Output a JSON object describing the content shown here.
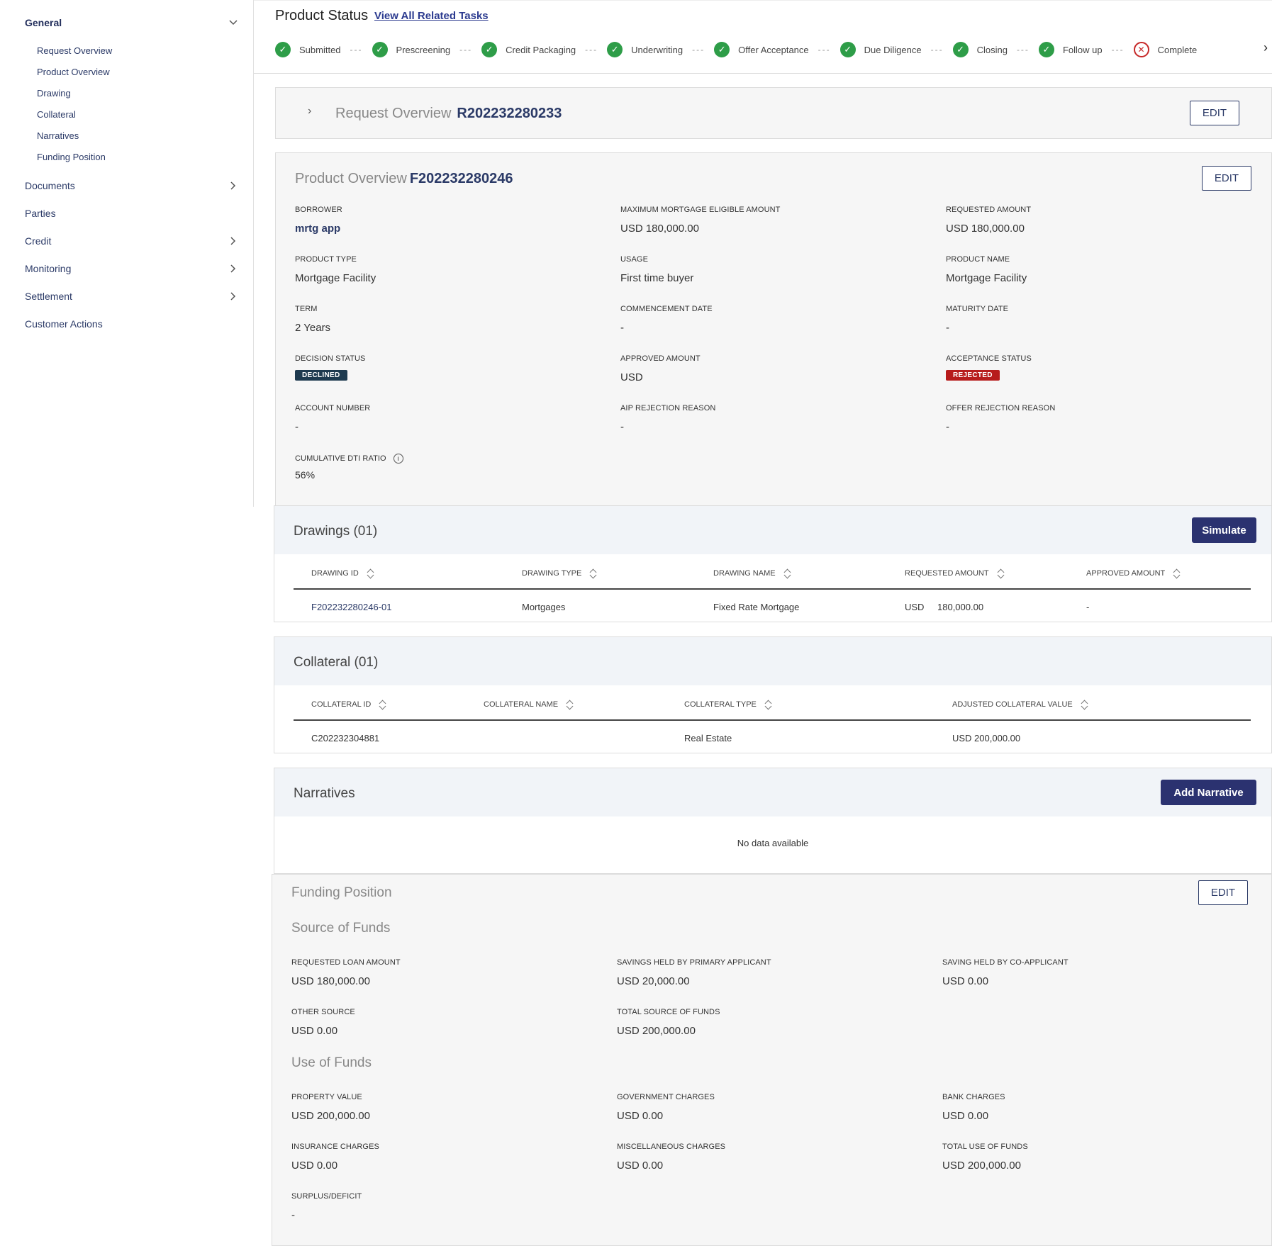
{
  "sidebar": {
    "groups": [
      {
        "label": "General"
      },
      {
        "label": "Documents"
      },
      {
        "label": "Parties"
      },
      {
        "label": "Credit"
      },
      {
        "label": "Monitoring"
      },
      {
        "label": "Settlement"
      },
      {
        "label": "Customer Actions"
      }
    ],
    "general_items": [
      {
        "label": "Request Overview"
      },
      {
        "label": "Product Overview"
      },
      {
        "label": "Drawing"
      },
      {
        "label": "Collateral"
      },
      {
        "label": "Narratives"
      },
      {
        "label": "Funding Position"
      }
    ]
  },
  "status": {
    "title": "Product Status",
    "link": "View All Related Tasks",
    "steps": [
      {
        "label": "Submitted",
        "state": "done"
      },
      {
        "label": "Prescreening",
        "state": "done"
      },
      {
        "label": "Credit Packaging",
        "state": "done"
      },
      {
        "label": "Underwriting",
        "state": "done"
      },
      {
        "label": "Offer Acceptance",
        "state": "done"
      },
      {
        "label": "Due Diligence",
        "state": "done"
      },
      {
        "label": "Closing",
        "state": "done"
      },
      {
        "label": "Follow up",
        "state": "done"
      },
      {
        "label": "Complete",
        "state": "failed"
      }
    ]
  },
  "request_overview": {
    "title": "Request Overview",
    "id": "R202232280233",
    "edit": "EDIT"
  },
  "product_overview": {
    "title": "Product Overview",
    "id": "F202232280246",
    "edit": "EDIT",
    "fields": {
      "borrower": {
        "label": "BORROWER",
        "value": "mrtg app"
      },
      "max_mortgage": {
        "label": "MAXIMUM MORTGAGE ELIGIBLE AMOUNT",
        "value": "USD 180,000.00"
      },
      "requested_amount": {
        "label": "REQUESTED AMOUNT",
        "value": "USD 180,000.00"
      },
      "product_type": {
        "label": "PRODUCT TYPE",
        "value": "Mortgage Facility"
      },
      "usage": {
        "label": "USAGE",
        "value": "First time buyer"
      },
      "product_name": {
        "label": "PRODUCT NAME",
        "value": "Mortgage Facility"
      },
      "term": {
        "label": "TERM",
        "value": "2 Years"
      },
      "commencement": {
        "label": "COMMENCEMENT DATE",
        "value": "-"
      },
      "maturity": {
        "label": "MATURITY DATE",
        "value": "-"
      },
      "decision_status": {
        "label": "DECISION STATUS",
        "value": "DECLINED"
      },
      "approved_amount": {
        "label": "APPROVED AMOUNT",
        "value": "USD"
      },
      "acceptance_status": {
        "label": "ACCEPTANCE STATUS",
        "value": "REJECTED"
      },
      "account_number": {
        "label": "ACCOUNT NUMBER",
        "value": "-"
      },
      "aip_rejection": {
        "label": "AIP REJECTION REASON",
        "value": "-"
      },
      "offer_rejection": {
        "label": "OFFER REJECTION REASON",
        "value": "-"
      },
      "dti": {
        "label": "CUMULATIVE DTI RATIO",
        "value": "56%"
      }
    },
    "colors": {
      "declined": "#1e3a4f",
      "rejected": "#b71c1c"
    }
  },
  "drawings": {
    "title": "Drawings (01)",
    "button": "Simulate",
    "columns": [
      "DRAWING ID",
      "DRAWING TYPE",
      "DRAWING NAME",
      "REQUESTED AMOUNT",
      "APPROVED AMOUNT"
    ],
    "rows": [
      {
        "id": "F202232280246-01",
        "type": "Mortgages",
        "name": "Fixed Rate Mortgage",
        "currency": "USD",
        "requested": "180,000.00",
        "approved": "-"
      }
    ]
  },
  "collateral": {
    "title": "Collateral (01)",
    "columns": [
      "COLLATERAL ID",
      "COLLATERAL NAME",
      "COLLATERAL TYPE",
      "ADJUSTED COLLATERAL VALUE"
    ],
    "rows": [
      {
        "id": "C202232304881",
        "name": "",
        "type": "Real Estate",
        "value": "USD 200,000.00"
      }
    ]
  },
  "narratives": {
    "title": "Narratives",
    "button": "Add Narrative",
    "empty": "No data available"
  },
  "funding": {
    "title": "Funding Position",
    "edit": "EDIT",
    "source_title": "Source of Funds",
    "source": {
      "requested_loan": {
        "label": "REQUESTED LOAN AMOUNT",
        "value": "USD 180,000.00"
      },
      "savings_primary": {
        "label": "SAVINGS HELD BY PRIMARY APPLICANT",
        "value": "USD 20,000.00"
      },
      "saving_co": {
        "label": "SAVING HELD BY CO-APPLICANT",
        "value": "USD 0.00"
      },
      "other": {
        "label": "OTHER SOURCE",
        "value": "USD 0.00"
      },
      "total": {
        "label": "TOTAL SOURCE OF FUNDS",
        "value": "USD 200,000.00"
      }
    },
    "use_title": "Use of Funds",
    "use": {
      "property": {
        "label": "PROPERTY VALUE",
        "value": "USD 200,000.00"
      },
      "government": {
        "label": "GOVERNMENT CHARGES",
        "value": "USD 0.00"
      },
      "bank": {
        "label": "BANK CHARGES",
        "value": "USD 0.00"
      },
      "insurance": {
        "label": "INSURANCE CHARGES",
        "value": "USD 0.00"
      },
      "misc": {
        "label": "MISCELLANEOUS CHARGES",
        "value": "USD 0.00"
      },
      "total": {
        "label": "TOTAL USE OF FUNDS",
        "value": "USD 200,000.00"
      },
      "surplus": {
        "label": "SURPLUS/DEFICIT",
        "value": "-"
      }
    }
  }
}
